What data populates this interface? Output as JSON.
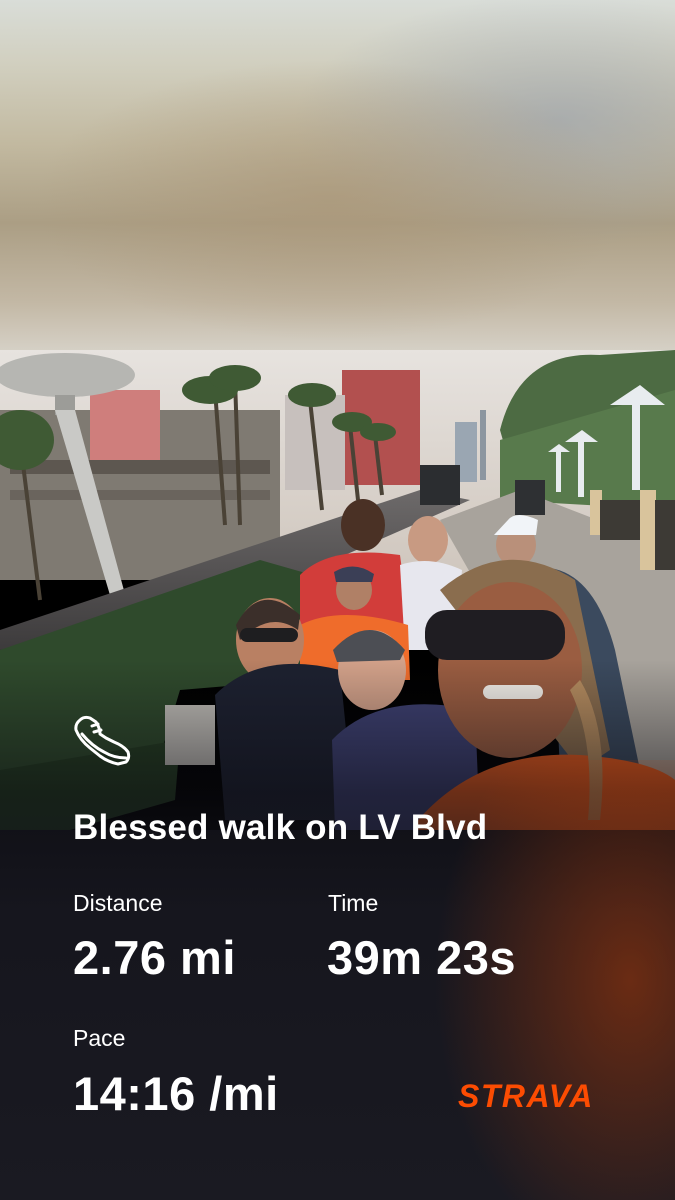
{
  "activity": {
    "title": "Blessed walk on LV Blvd",
    "icon": "walking-shoe-icon"
  },
  "stats": {
    "distance": {
      "label": "Distance",
      "value": "2.76 mi"
    },
    "time": {
      "label": "Time",
      "value": "39m 23s"
    },
    "pace": {
      "label": "Pace",
      "value": "14:16 /mi"
    }
  },
  "brand": {
    "name": "STRAVA",
    "color": "#fc4c02"
  },
  "colors": {
    "text": "#ffffff",
    "overlay": "#1a1a22"
  }
}
